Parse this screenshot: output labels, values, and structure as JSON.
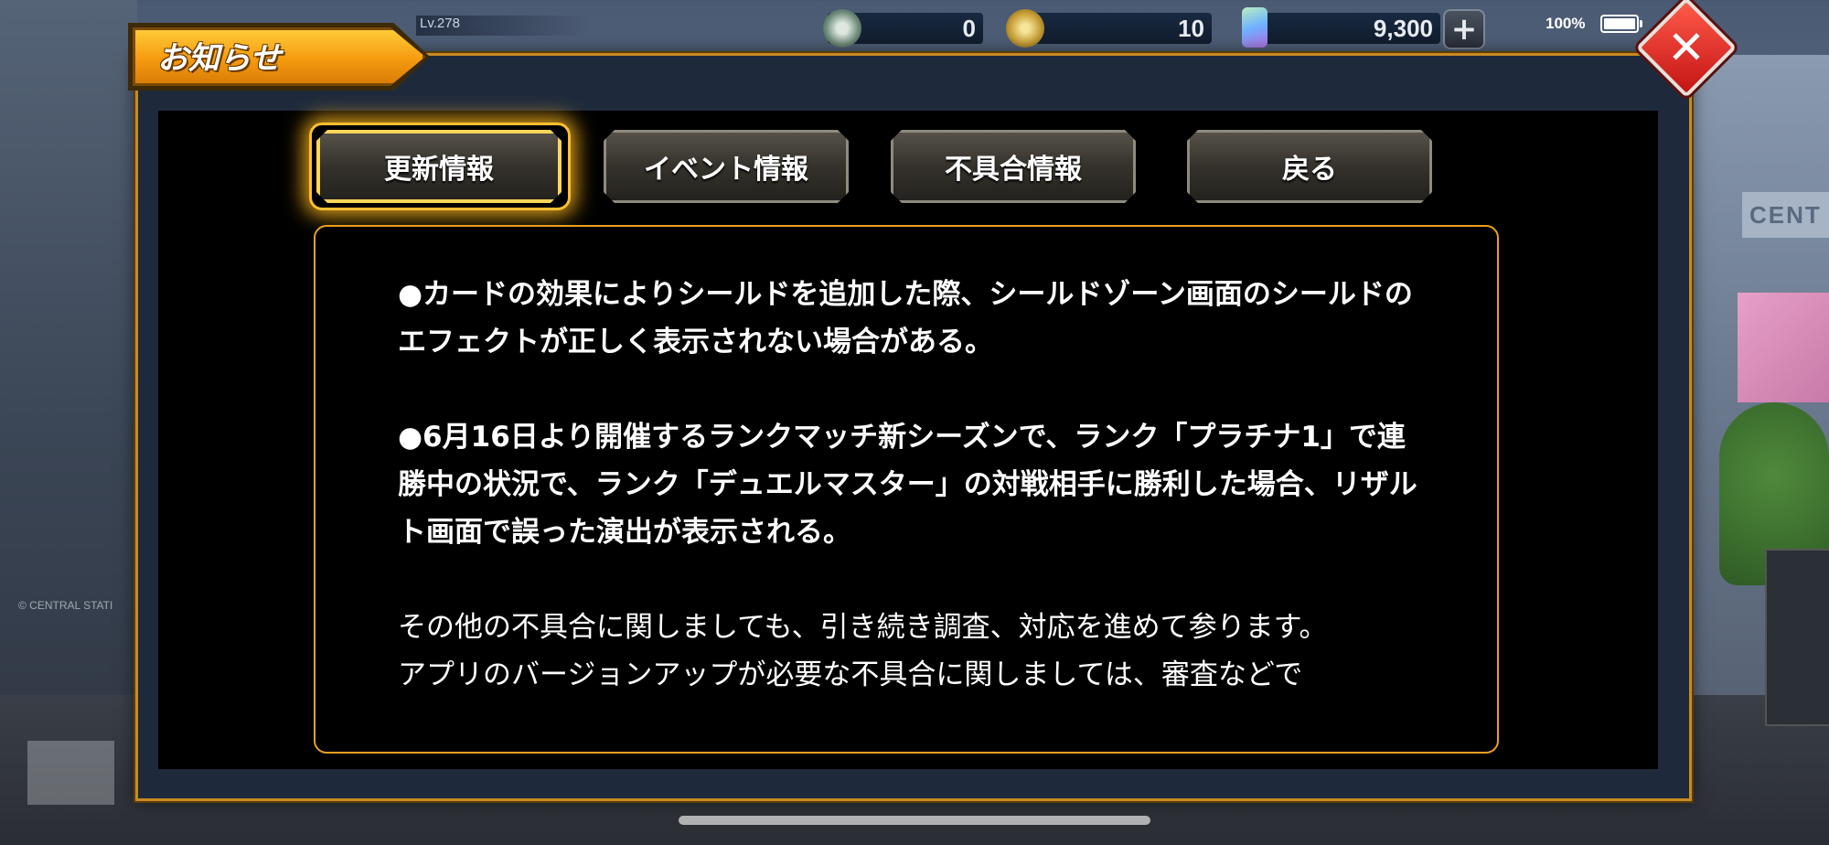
{
  "status_bar": {
    "level": "Lv.278",
    "ticket_count": "0",
    "coin_count": "10",
    "gem_count": "9,300",
    "plus_label": "+",
    "battery": "100%"
  },
  "background": {
    "center_sign": "CENT",
    "station_sign": "© CENTRAL STATI"
  },
  "dialog": {
    "title": "お知らせ",
    "close_label": "✕",
    "tabs": [
      {
        "label": "更新情報",
        "active": true
      },
      {
        "label": "イベント情報",
        "active": false
      },
      {
        "label": "不具合情報",
        "active": false
      },
      {
        "label": "戻る",
        "active": false
      }
    ],
    "content": {
      "paragraphs": [
        "●カードの効果によりシールドを追加した際、シールドゾーン画面のシールドのエフェクトが正しく表示されない場合がある。",
        "●6月16日より開催するランクマッチ新シーズンで、ランク「プラチナ1」で連勝中の状況で、ランク「デュエルマスター」の対戦相手に勝利した場合、リザルト画面で誤った演出が表示される。",
        "その他の不具合に関しましても、引き続き調査、対応を進めて参ります。",
        "アプリのバージョンアップが必要な不具合に関しましては、審査などで"
      ]
    }
  },
  "colors": {
    "accent": "#f59a10",
    "panel_border": "#c88a22",
    "close": "#d42020",
    "content_border": "#e8a020"
  }
}
